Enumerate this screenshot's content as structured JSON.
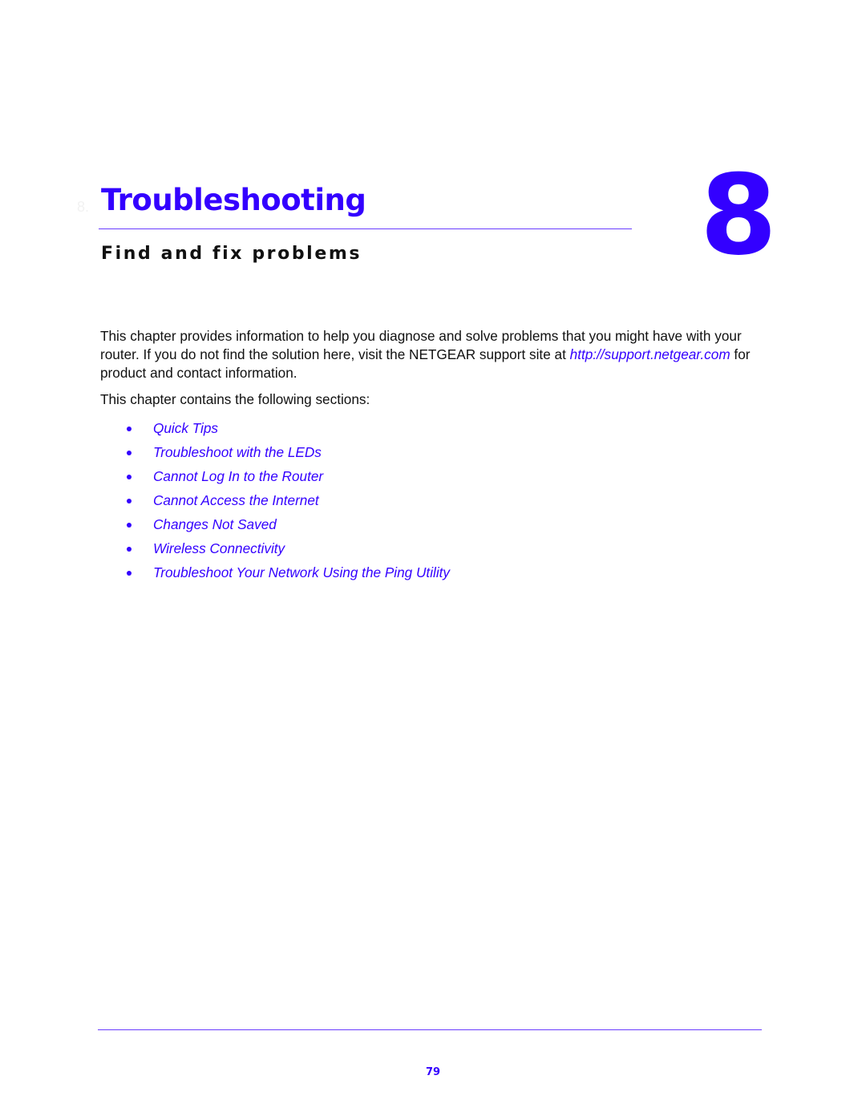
{
  "chapter": {
    "ghost_label": "8.",
    "title": "Troubleshooting",
    "subtitle": "Find and fix problems",
    "number": "8"
  },
  "intro": {
    "text_before_link": "This chapter provides information to help you diagnose and solve problems that you might have with your router. If you do not find the solution here, visit the NETGEAR support site at ",
    "link": "http://support.netgear.com",
    "text_after_link": " for product and contact information.",
    "sections_intro": "This chapter contains the following sections:"
  },
  "sections": [
    {
      "label": "Quick Tips"
    },
    {
      "label": "Troubleshoot with the LEDs"
    },
    {
      "label": "Cannot Log In to the Router"
    },
    {
      "label": "Cannot Access the Internet"
    },
    {
      "label": "Changes Not Saved"
    },
    {
      "label": "Wireless Connectivity"
    },
    {
      "label": "Troubleshoot Your Network Using the Ping Utility"
    }
  ],
  "footer": {
    "page_number": "79"
  },
  "colors": {
    "accent": "#3300ff",
    "text": "#111111"
  }
}
